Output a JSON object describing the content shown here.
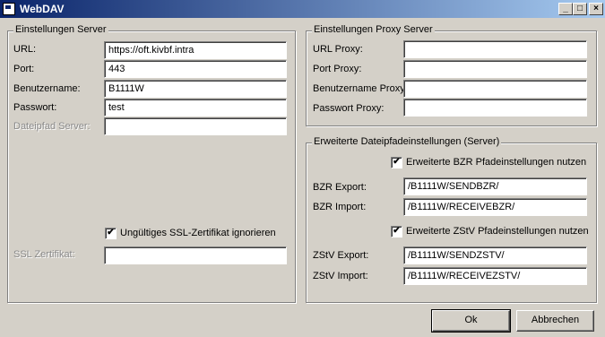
{
  "window": {
    "title": "WebDAV",
    "minimize_glyph": "_",
    "maximize_glyph": "□",
    "close_glyph": "×"
  },
  "server": {
    "legend": "Einstellungen Server",
    "url_label": "URL:",
    "url_value": "https://oft.kivbf.intra",
    "port_label": "Port:",
    "port_value": "443",
    "username_label": "Benutzername:",
    "username_value": "B1111W",
    "password_label": "Passwort:",
    "password_value": "test",
    "filepath_label": "Dateipfad Server:",
    "filepath_value": "",
    "ssl_ignore_label": "Ungültiges SSL-Zertifikat ignorieren",
    "ssl_ignore_checked": true,
    "ssl_cert_label": "SSL Zertifikat:",
    "ssl_cert_value": ""
  },
  "proxy": {
    "legend": "Einstellungen Proxy Server",
    "url_label": "URL Proxy:",
    "url_value": "",
    "port_label": "Port Proxy:",
    "port_value": "",
    "username_label": "Benutzername Proxy:",
    "username_value": "",
    "password_label": "Passwort Proxy:",
    "password_value": ""
  },
  "advanced": {
    "legend": "Erweiterte Dateipfadeinstellungen (Server)",
    "bzr_checkbox_label": "Erweiterte BZR Pfadeinstellungen nutzen",
    "bzr_checked": true,
    "bzr_export_label": "BZR Export:",
    "bzr_export_value": "/B1111W/SENDBZR/",
    "bzr_import_label": "BZR Import:",
    "bzr_import_value": "/B1111W/RECEIVEBZR/",
    "zstv_checkbox_label": "Erweiterte ZStV Pfadeinstellungen nutzen",
    "zstv_checked": true,
    "zstv_export_label": "ZStV Export:",
    "zstv_export_value": "/B1111W/SENDZSTV/",
    "zstv_import_label": "ZStV Import:",
    "zstv_import_value": "/B1111W/RECEIVEZSTV/"
  },
  "buttons": {
    "ok_label": "Ok",
    "cancel_label": "Abbrechen"
  },
  "check_glyph": "✔"
}
